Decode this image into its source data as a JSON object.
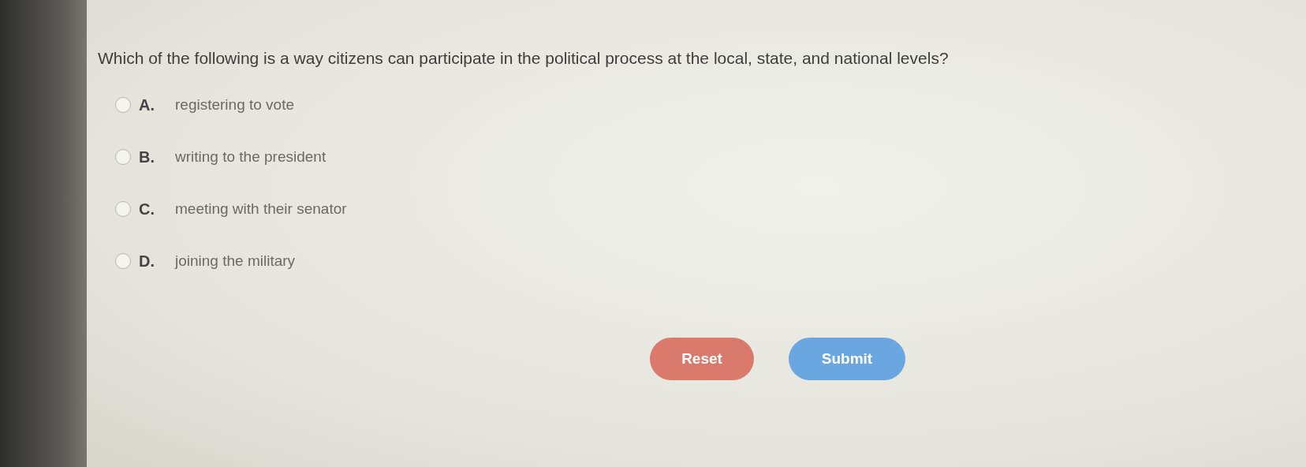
{
  "question": "Which of the following is a way citizens can participate in the political process at the local, state, and national levels?",
  "options": [
    {
      "letter": "A.",
      "text": "registering to vote",
      "selected": false
    },
    {
      "letter": "B.",
      "text": "writing to the president",
      "selected": false
    },
    {
      "letter": "C.",
      "text": "meeting with their senator",
      "selected": false
    },
    {
      "letter": "D.",
      "text": "joining the military",
      "selected": false
    }
  ],
  "buttons": [
    {
      "label": "Reset",
      "kind": "reset"
    },
    {
      "label": "Submit",
      "kind": "submit"
    }
  ]
}
